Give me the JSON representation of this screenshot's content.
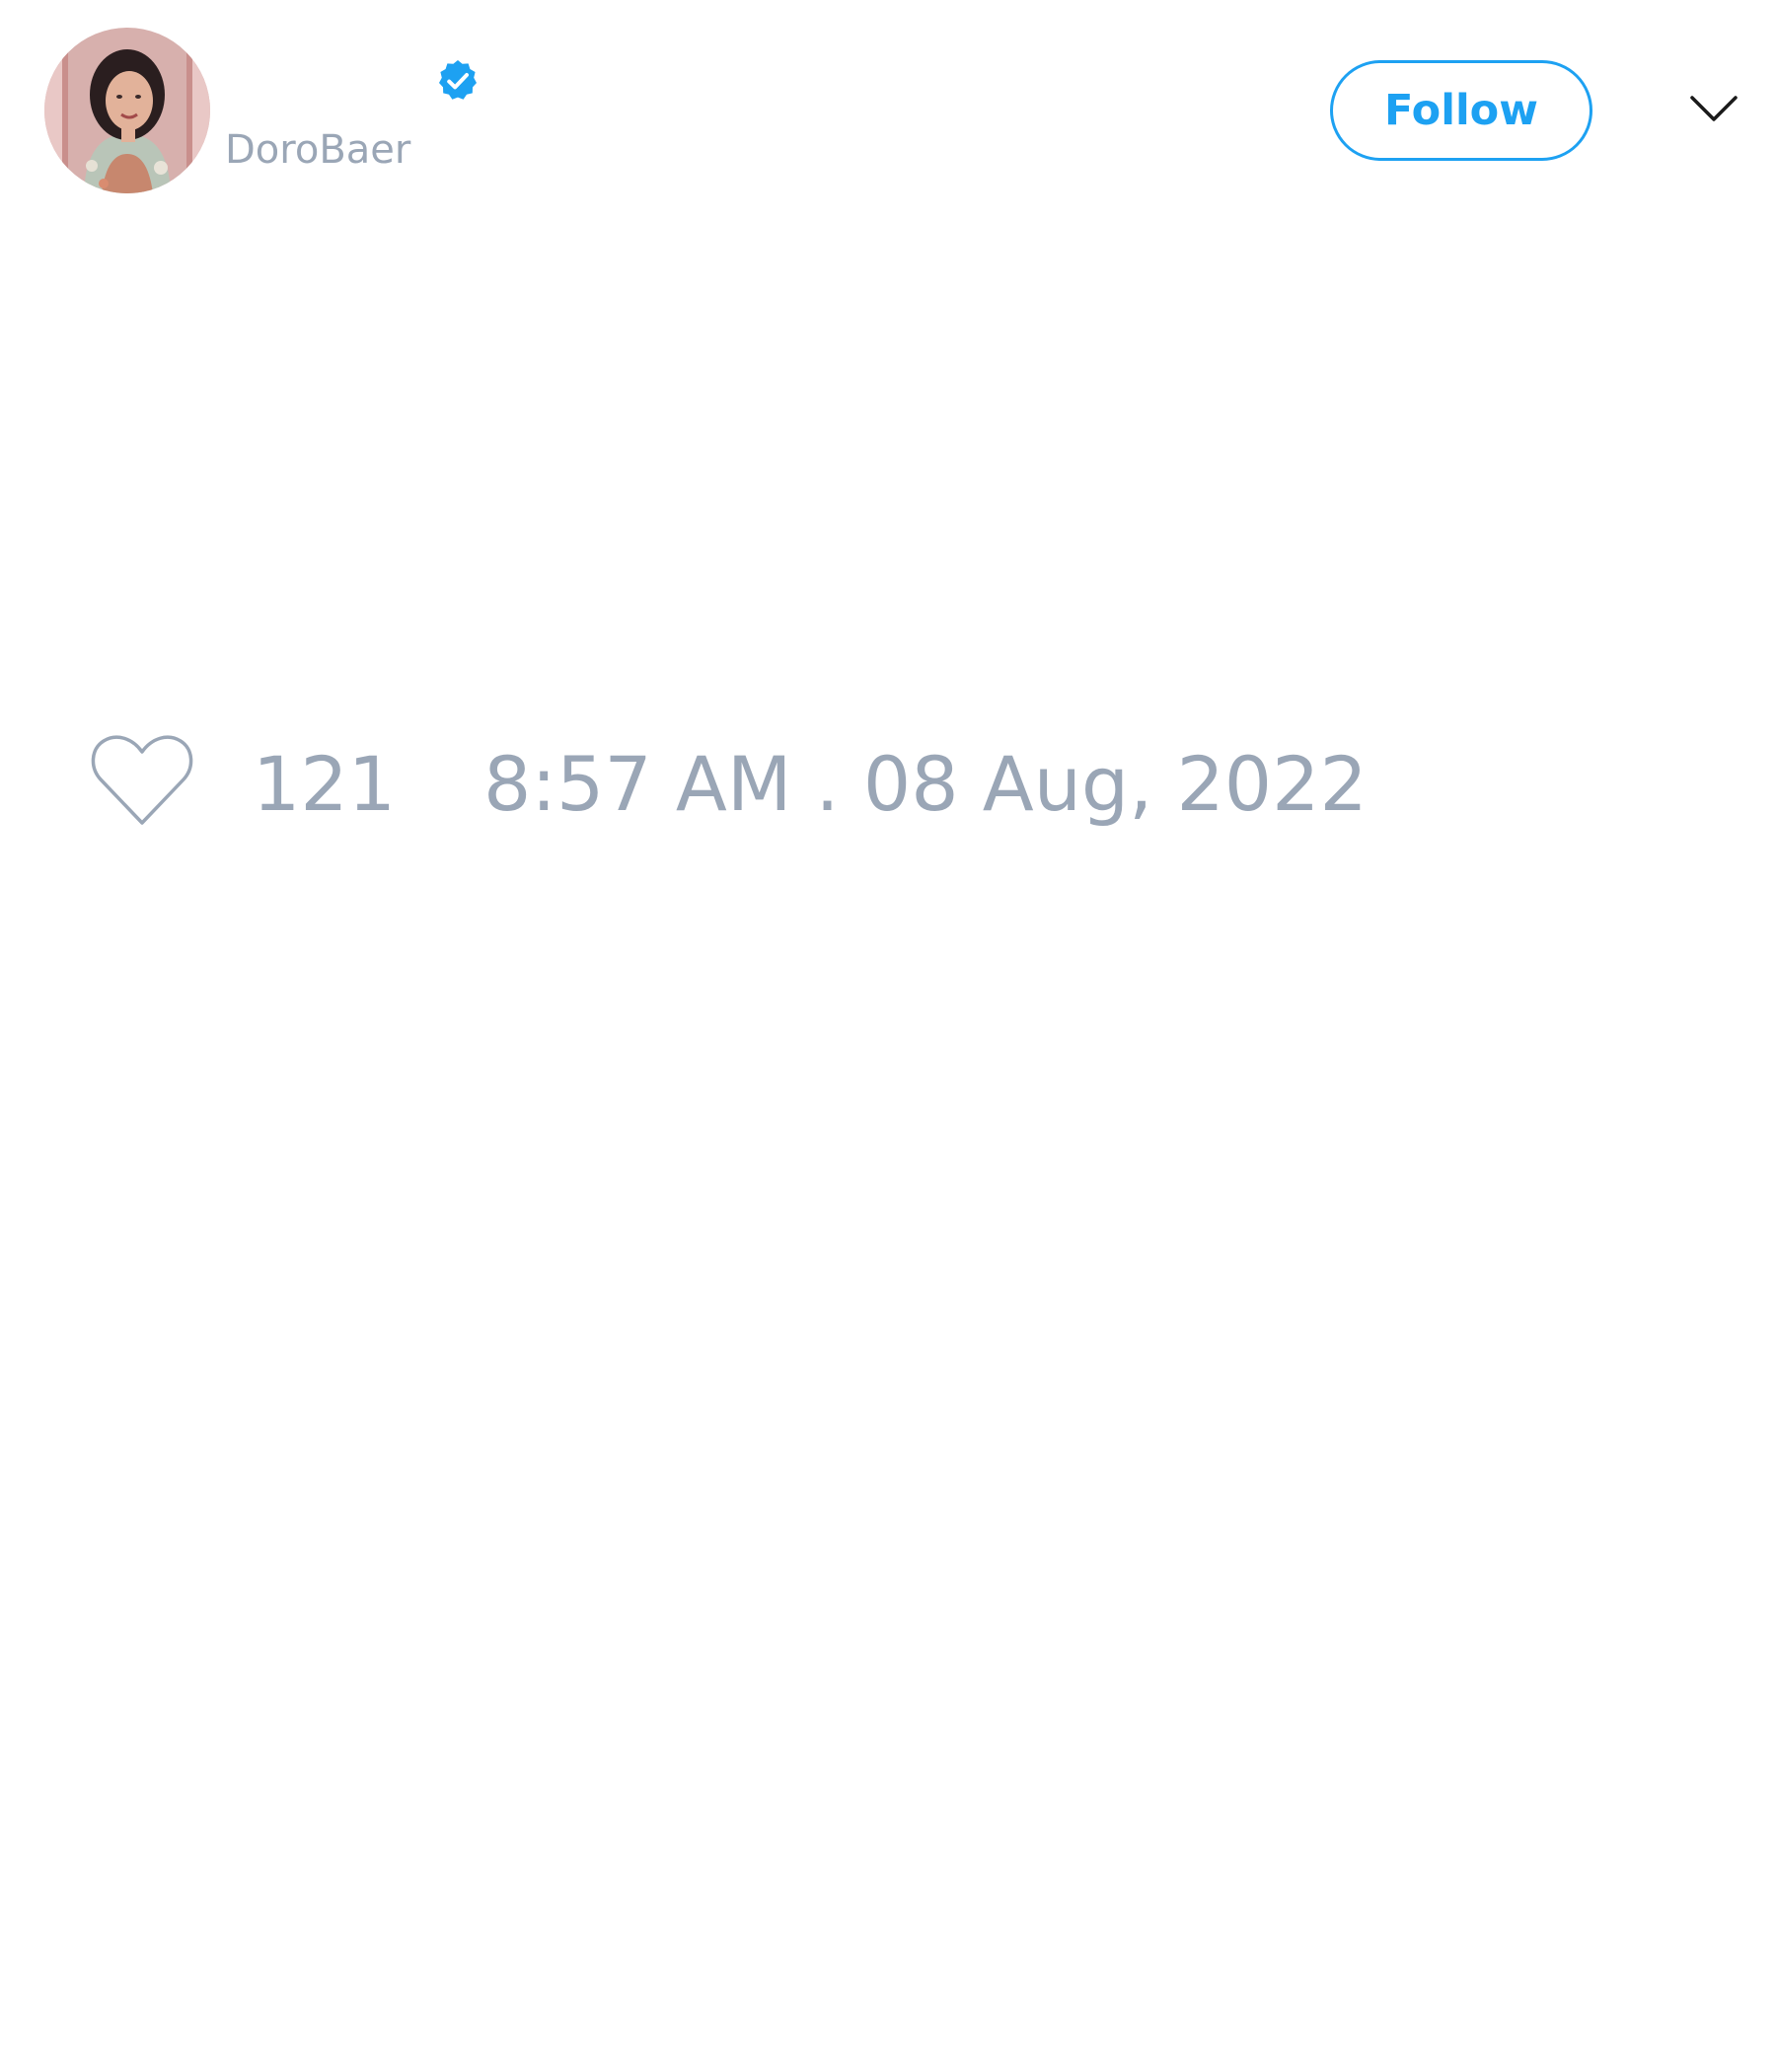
{
  "header": {
    "username": "DoroBaer",
    "follow_label": "Follow",
    "verified": true,
    "avatar_icon": "profile-photo"
  },
  "footer": {
    "like_count": "121",
    "timestamp": "8:57 AM . 08 Aug, 2022",
    "like_icon": "heart-outline-icon"
  },
  "colors": {
    "accent": "#1da1f2",
    "muted_text": "#9aa6b6"
  }
}
